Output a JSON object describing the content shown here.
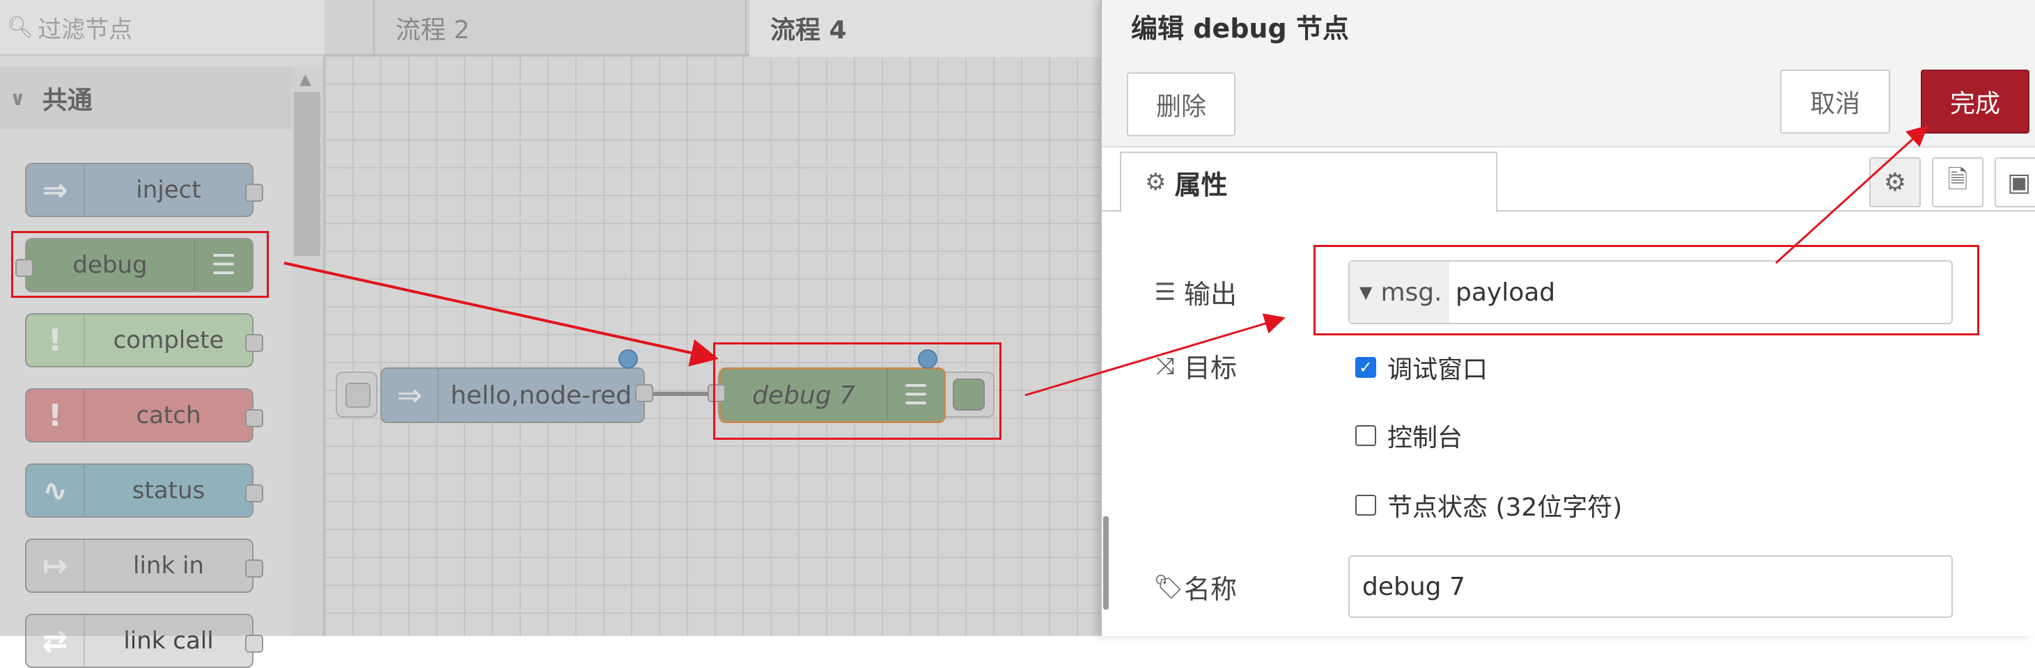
{
  "palette": {
    "search_placeholder": "过滤节点",
    "category": "共通",
    "nodes": [
      {
        "label": "inject",
        "color": "#a6bbcf",
        "icon": "arrow-right-icon"
      },
      {
        "label": "debug",
        "color": "#87a980",
        "icon": "list-icon"
      },
      {
        "label": "complete",
        "color": "#c0deb4",
        "icon": "exclamation-icon"
      },
      {
        "label": "catch",
        "color": "#e49191",
        "icon": "exclamation-icon"
      },
      {
        "label": "status",
        "color": "#94c1d0",
        "icon": "pulse-icon"
      },
      {
        "label": "link in",
        "color": "#dddddd",
        "icon": "link-in-icon"
      },
      {
        "label": "link call",
        "color": "#dddddd",
        "icon": "link-call-icon"
      }
    ]
  },
  "workspace": {
    "tabs": [
      {
        "label": "流程 2"
      },
      {
        "label": "流程 4"
      }
    ],
    "flow_nodes": [
      {
        "label": "hello,node-red",
        "color": "#a6bbcf"
      },
      {
        "label": "debug 7",
        "color": "#87a980"
      }
    ]
  },
  "tray": {
    "title": "编辑 debug 节点",
    "delete_label": "删除",
    "cancel_label": "取消",
    "done_label": "完成",
    "tab_properties": "属性",
    "output_label": "输出",
    "output_type": "msg.",
    "output_value": "payload",
    "target_label": "目标",
    "targets": [
      {
        "label": "调试窗口",
        "checked": true
      },
      {
        "label": "控制台",
        "checked": false
      },
      {
        "label": "节点状态 (32位字符)",
        "checked": false
      }
    ],
    "name_label": "名称",
    "name_value": "debug 7"
  },
  "colors": {
    "accent": "#a61e2a",
    "annotation": "#e0141e",
    "checkbox": "#1a73e8"
  }
}
